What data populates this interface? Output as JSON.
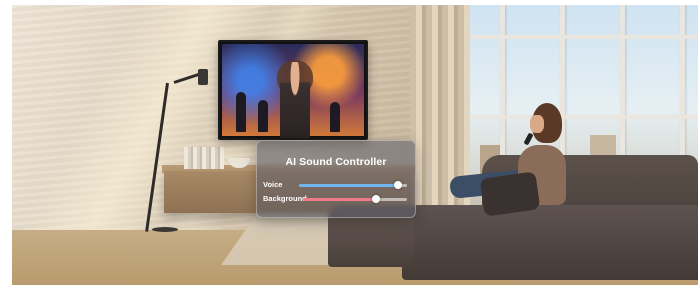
{
  "controller": {
    "title": "AI Sound Controller",
    "sliders": [
      {
        "label": "Voice",
        "level": 0.92,
        "color": "#6fb6f0"
      },
      {
        "label": "Background",
        "level": 0.7,
        "color": "#f07a8a"
      }
    ]
  },
  "scene": {
    "icons": [
      "tv-icon",
      "floor-lamp-icon",
      "sofa-icon",
      "remote-icon"
    ]
  }
}
